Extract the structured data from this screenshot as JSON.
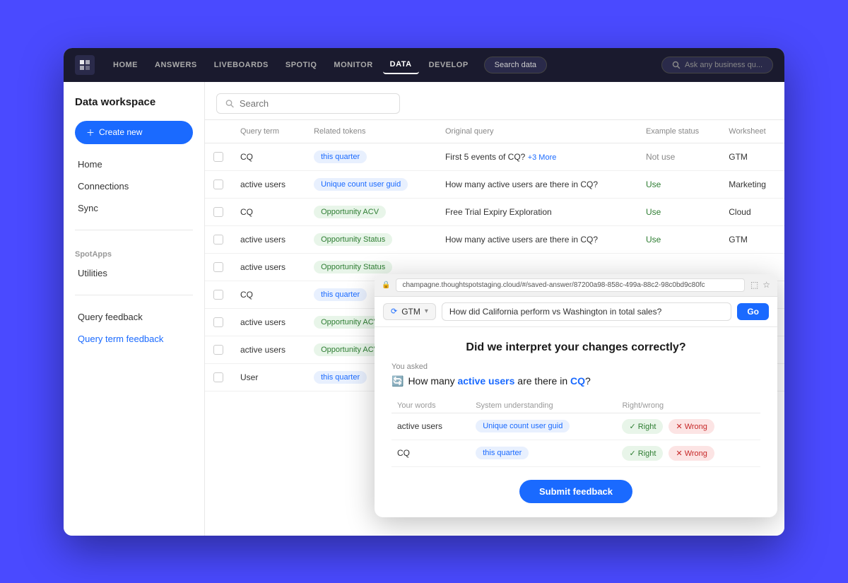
{
  "nav": {
    "logo": "T",
    "items": [
      {
        "label": "HOME",
        "active": false
      },
      {
        "label": "ANSWERS",
        "active": false
      },
      {
        "label": "LIVEBOARDS",
        "active": false
      },
      {
        "label": "SPOTIQ",
        "active": false
      },
      {
        "label": "MONITOR",
        "active": false
      },
      {
        "label": "DATA",
        "active": true
      },
      {
        "label": "DEVELOP",
        "active": false
      }
    ],
    "search_data": "Search data",
    "ask_placeholder": "Ask any business qu..."
  },
  "sidebar": {
    "title": "Data workspace",
    "create_btn": "+ Create new",
    "items_main": [
      {
        "label": "Home",
        "section": ""
      },
      {
        "label": "Connections",
        "section": ""
      },
      {
        "label": "Sync",
        "section": ""
      }
    ],
    "section_spotapps": "SpotApps",
    "items_spotapps": [
      {
        "label": "Utilities"
      }
    ],
    "section_feedback": "",
    "items_feedback": [
      {
        "label": "Query feedback",
        "active": false
      },
      {
        "label": "Query term feedback",
        "active": true
      }
    ]
  },
  "table": {
    "search_placeholder": "Search",
    "columns": [
      "",
      "Query term",
      "Related tokens",
      "Original query",
      "Example status",
      "Worksheet"
    ],
    "rows": [
      {
        "query_term": "CQ",
        "token": "this quarter",
        "token_type": "blue",
        "original_query": "First 5 events of CQ?",
        "more_count": "+3 More",
        "example_status": "Not use",
        "status_class": "notuse",
        "worksheet": "GTM"
      },
      {
        "query_term": "active users",
        "token": "Unique count user guid",
        "token_type": "blue",
        "original_query": "How many active users are there in CQ?",
        "more_count": "",
        "example_status": "Use",
        "status_class": "use",
        "worksheet": "Marketing"
      },
      {
        "query_term": "CQ",
        "token": "Opportunity ACV",
        "token_type": "green",
        "original_query": "Free Trial Expiry Exploration",
        "more_count": "",
        "example_status": "Use",
        "status_class": "use",
        "worksheet": "Cloud"
      },
      {
        "query_term": "active users",
        "token": "Opportunity Status",
        "token_type": "green",
        "original_query": "How many active users are there in CQ?",
        "more_count": "",
        "example_status": "Use",
        "status_class": "use",
        "worksheet": "GTM"
      },
      {
        "query_term": "active users",
        "token": "Opportunity Status",
        "token_type": "green",
        "original_query": "",
        "more_count": "",
        "example_status": "",
        "status_class": "",
        "worksheet": ""
      },
      {
        "query_term": "CQ",
        "token": "this quarter",
        "token_type": "blue",
        "original_query": "",
        "more_count": "",
        "example_status": "",
        "status_class": "",
        "worksheet": ""
      },
      {
        "query_term": "active users",
        "token": "Opportunity ACV",
        "token_type": "green",
        "original_query": "",
        "more_count": "",
        "example_status": "",
        "status_class": "",
        "worksheet": ""
      },
      {
        "query_term": "active users",
        "token": "Opportunity ACV",
        "token_type": "green",
        "original_query": "",
        "more_count": "",
        "example_status": "",
        "status_class": "",
        "worksheet": ""
      },
      {
        "query_term": "User",
        "token": "this quarter",
        "token_type": "blue",
        "original_query": "",
        "more_count": "",
        "example_status": "",
        "status_class": "",
        "worksheet": ""
      }
    ]
  },
  "popup": {
    "url": "champagne.thoughtspotstaging.cloud/#/saved-answer/87200a98-858c-499a-88c2-98c0bd9c80fc",
    "gtm_label": "GTM",
    "query_value": "How did California perform vs Washington in total sales?",
    "go_btn": "Go",
    "title": "Did we interpret your changes correctly?",
    "you_asked_label": "You asked",
    "query_display": "How many active users are there in CQ?",
    "query_highlight_words": [
      "active users",
      "CQ"
    ],
    "your_words_col": "Your words",
    "system_col": "System understanding",
    "rw_col": "Right/wrong",
    "feedback_rows": [
      {
        "word": "active users",
        "understanding": "Unique count user guid",
        "right": "Right",
        "wrong": "Wrong"
      },
      {
        "word": "CQ",
        "understanding": "this quarter",
        "right": "Right",
        "wrong": "Wrong"
      }
    ],
    "submit_label": "Submit feedback"
  }
}
